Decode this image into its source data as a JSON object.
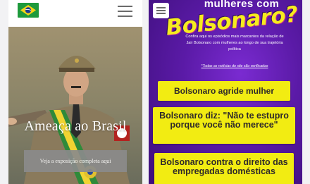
{
  "left_page": {
    "header": {
      "logo_icon": "brazil-flag-icon",
      "menu_icon": "hamburger-icon"
    },
    "hero": {
      "title": "Ameaça ao Brasil",
      "cta_label": "Veja a exposição completa aqui"
    }
  },
  "right_page": {
    "menu_icon": "hamburger-icon",
    "heading_small": "mulheres com",
    "heading_big": "Bolsonaro?",
    "intro": "Confira aqui os episódios mais marcantes da relação de Jair Bolsonaro com mulheres ao longo de sua trajetória política",
    "note": "*Todas as notícias do site são verificadas",
    "cards": [
      {
        "text": "Bolsonaro agride mulher"
      },
      {
        "text": "Bolsonaro diz: \"Não te estupro porque você não merece\""
      },
      {
        "text": "Bolsonaro contra o direito das empregadas domésticas"
      }
    ]
  },
  "colors": {
    "card_yellow": "#f2ec12",
    "purple_bg": "#5a1aa6",
    "flag_green": "#1e9a3c"
  }
}
